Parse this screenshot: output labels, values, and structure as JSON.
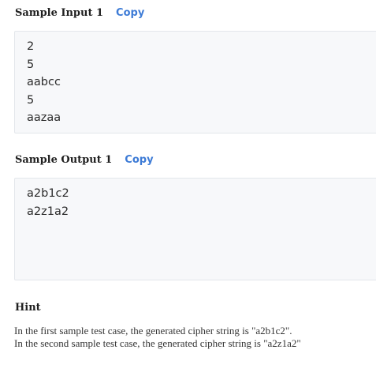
{
  "sample_input": {
    "title": "Sample Input 1",
    "copy_label": "Copy",
    "lines": [
      "2",
      "5",
      "aabcc",
      "5",
      "aazaa"
    ]
  },
  "sample_output": {
    "title": "Sample Output 1",
    "copy_label": "Copy",
    "lines": [
      "a2b1c2",
      "a2z1a2"
    ]
  },
  "hint": {
    "title": "Hint",
    "lines": [
      "In the first sample test case, the generated cipher string is \"a2b1c2\".",
      "In the second sample test case, the generated cipher string is \"a2z1a2\""
    ]
  },
  "colors": {
    "link": "#3d7bd6",
    "code_background": "#f7f8fa",
    "code_border": "#e3e6eb"
  }
}
